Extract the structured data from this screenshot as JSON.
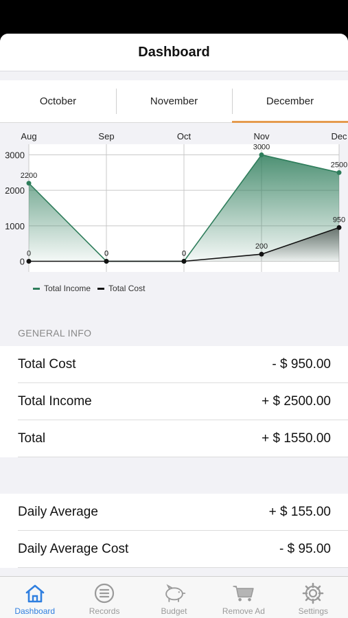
{
  "navbar": {
    "title": "Dashboard"
  },
  "segments": [
    {
      "label": "October",
      "active": false
    },
    {
      "label": "November",
      "active": false
    },
    {
      "label": "December",
      "active": true
    }
  ],
  "chart_data": {
    "type": "area",
    "x": [
      "Aug",
      "Sep",
      "Oct",
      "Nov",
      "Dec"
    ],
    "series": [
      {
        "name": "Total Income",
        "values": [
          2200,
          0,
          0,
          3000,
          2500
        ],
        "color": "#2e7d5b"
      },
      {
        "name": "Total Cost",
        "values": [
          0,
          0,
          0,
          200,
          950
        ],
        "color": "#111111"
      }
    ],
    "data_labels": {
      "Total Income": [
        "2200",
        "0",
        "0",
        "3000",
        "2500"
      ],
      "Total Cost": [
        "0",
        "0",
        "0",
        "200",
        "950"
      ]
    },
    "yticks": [
      0,
      1000,
      2000,
      3000
    ],
    "ylim": [
      -300,
      3300
    ],
    "grid": true,
    "legend_position": "bottom-left"
  },
  "general_info": {
    "header": "GENERAL INFO",
    "rows": [
      {
        "label": "Total Cost",
        "value": "- $ 950.00"
      },
      {
        "label": "Total Income",
        "value": "+ $ 2500.00"
      },
      {
        "label": "Total",
        "value": "+ $ 1550.00"
      }
    ]
  },
  "averages": {
    "rows": [
      {
        "label": "Daily Average",
        "value": "+ $ 155.00"
      },
      {
        "label": "Daily Average Cost",
        "value": "- $ 95.00"
      }
    ]
  },
  "tabbar": {
    "items": [
      {
        "label": "Dashboard",
        "icon": "home-icon",
        "active": true
      },
      {
        "label": "Records",
        "icon": "list-icon",
        "active": false
      },
      {
        "label": "Budget",
        "icon": "piggy-bank-icon",
        "active": false
      },
      {
        "label": "Remove Ad",
        "icon": "cart-icon",
        "active": false
      },
      {
        "label": "Settings",
        "icon": "gear-icon",
        "active": false
      }
    ]
  },
  "colors": {
    "accent": "#e59a4d",
    "active_tab": "#2f7fe0",
    "income": "#2e7d5b",
    "cost": "#111111"
  }
}
